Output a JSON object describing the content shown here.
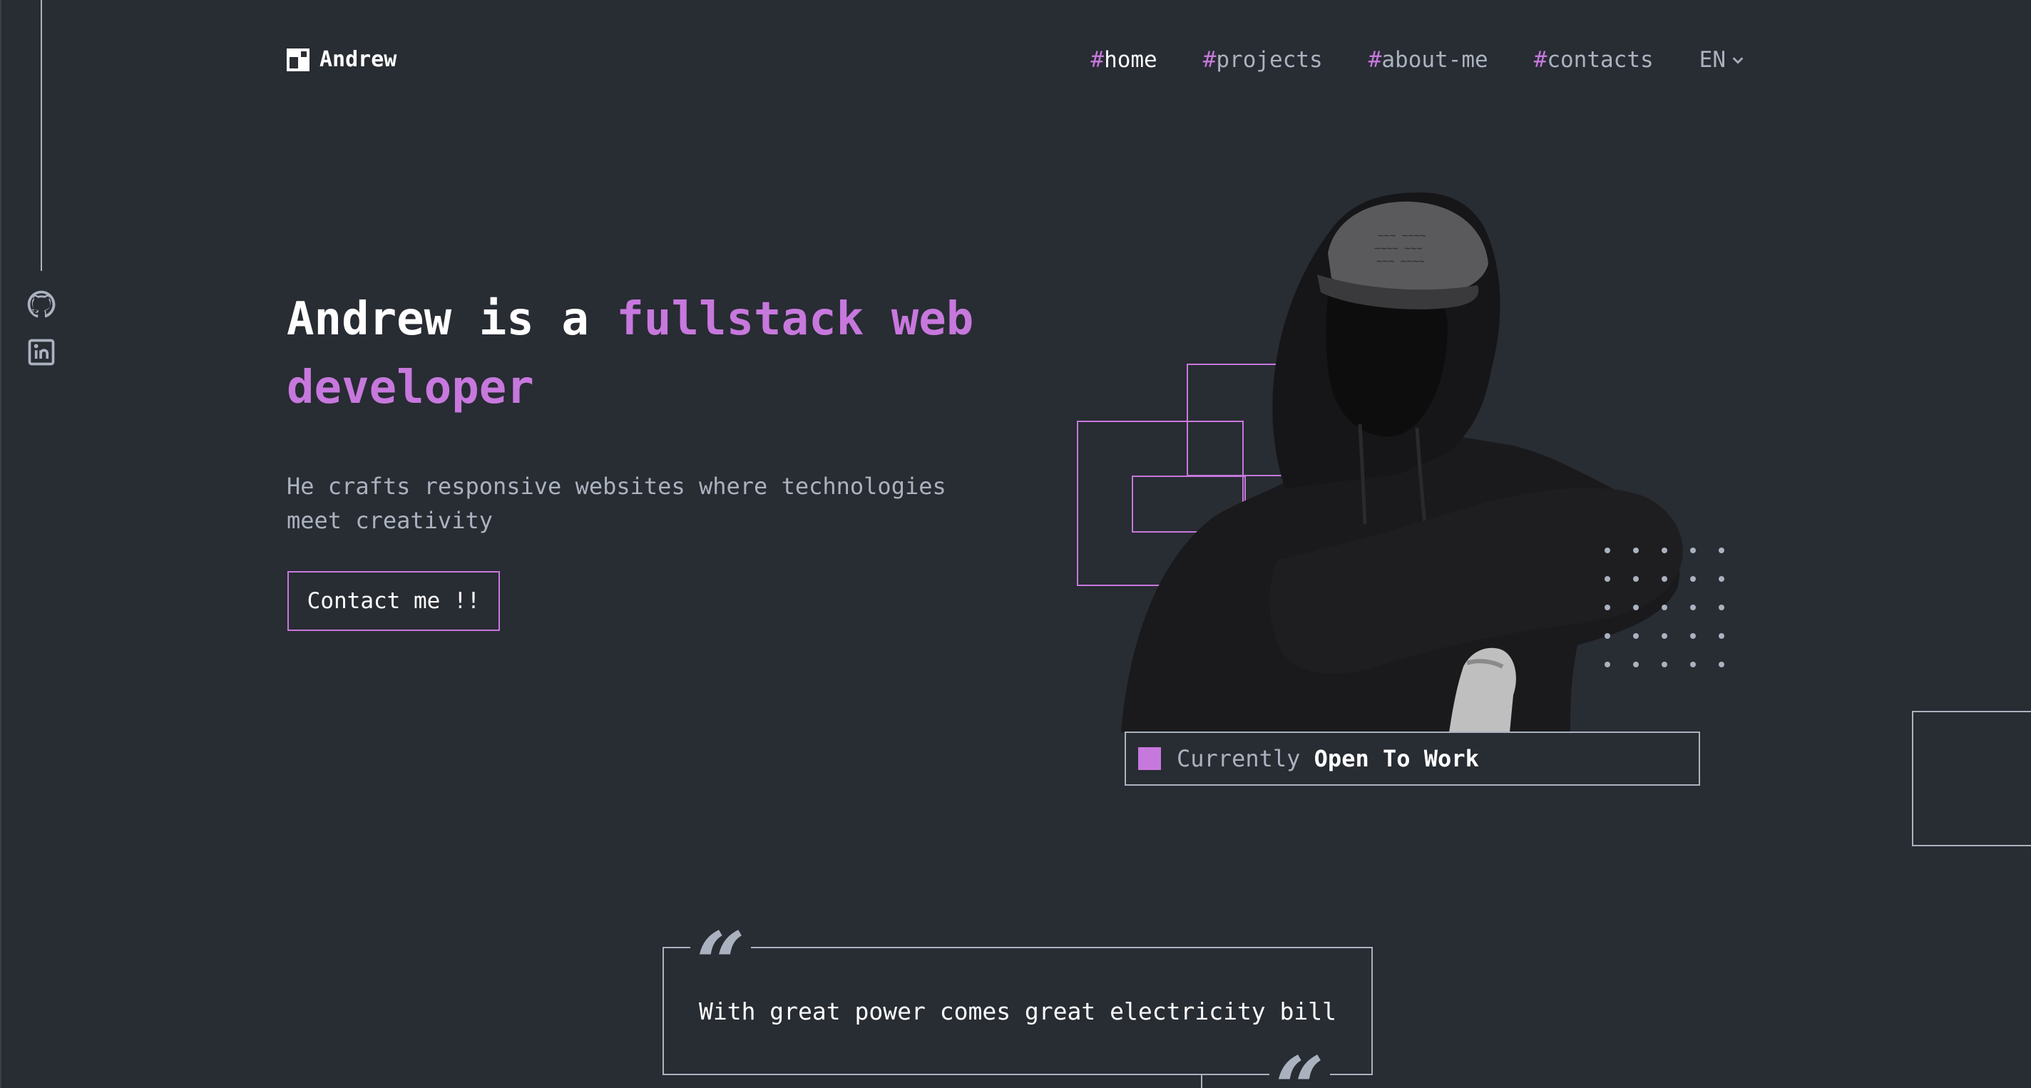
{
  "brand": {
    "name": "Andrew",
    "logo_icon": "logo-mark-icon"
  },
  "nav": {
    "items": [
      {
        "hash": "#",
        "label": "home",
        "active": true
      },
      {
        "hash": "#",
        "label": "projects",
        "active": false
      },
      {
        "hash": "#",
        "label": "about-me",
        "active": false
      },
      {
        "hash": "#",
        "label": "contacts",
        "active": false
      }
    ],
    "language": {
      "value": "EN",
      "icon": "chevron-down-icon"
    }
  },
  "social": [
    {
      "name": "GitHub",
      "icon": "github-icon"
    },
    {
      "name": "LinkedIn",
      "icon": "linkedin-icon"
    }
  ],
  "hero": {
    "title_plain": "Andrew is a ",
    "title_accent_1": "fullstack web",
    "title_accent_2": "developer",
    "subtitle": "He crafts responsive websites where technologies meet creativity",
    "cta_label": "Contact me !!"
  },
  "status": {
    "prefix": "Currently",
    "strong": "Open To Work"
  },
  "quote": {
    "open_mark": "“",
    "text": "With great power comes great electricity bill",
    "close_mark": "“"
  },
  "colors": {
    "background": "#282c33",
    "accent": "#c778dd",
    "text": "#abb2bf",
    "heading": "#ffffff"
  }
}
